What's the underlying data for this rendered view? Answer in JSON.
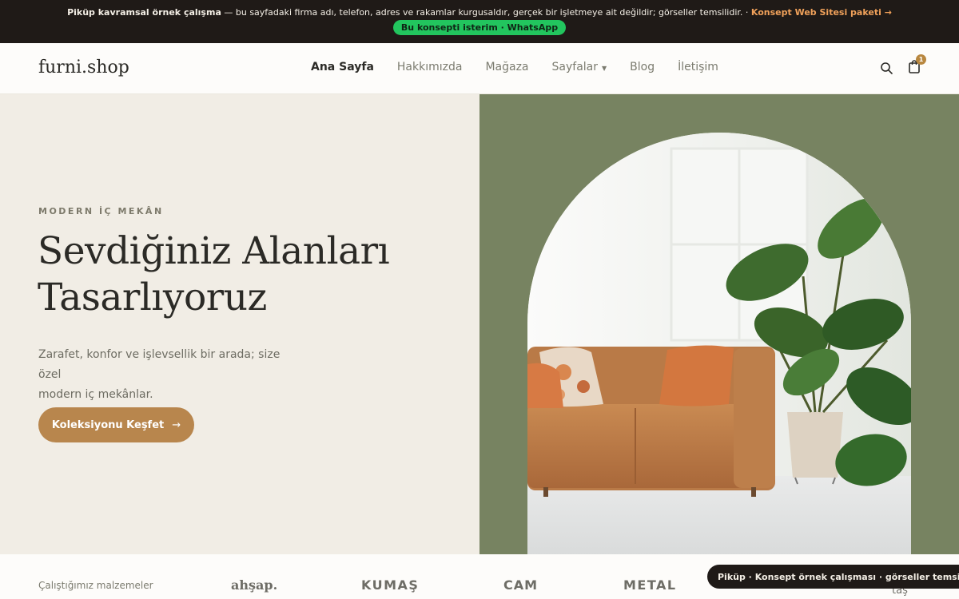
{
  "notice": {
    "strong": "Piküp kavramsal örnek çalışma",
    "text": " — bu sayfadaki firma adı, telefon, adres ve rakamlar kurgusaldır, gerçek bir işletmeye ait değildir; görseller temsilidir. · ",
    "link": "Konsept Web Sitesi paketi →",
    "whatsapp": "Bu konsepti isterim · WhatsApp"
  },
  "header": {
    "logo": "furni.shop",
    "nav": [
      "Ana Sayfa",
      "Hakkımızda",
      "Mağaza",
      "Sayfalar",
      "Blog",
      "İletişim"
    ],
    "active_nav": "Ana Sayfa",
    "cart_count": "1",
    "icons": [
      "search-icon",
      "shopping-bag-icon",
      "chevron-down-icon"
    ]
  },
  "hero": {
    "eyebrow": "MODERN İÇ MEKÂN",
    "title_line1": "Sevdiğiniz Alanları",
    "title_line2": "Tasarlıyoruz",
    "desc_line1": "Zarafet, konfor ve işlevsellik bir arada; size özel",
    "desc_line2": "modern iç mekânlar.",
    "cta": "Koleksiyonu Keşfet",
    "cta_arrow": "→"
  },
  "materials": {
    "label": "Çalıştığımız malzemeler",
    "items": [
      "ahşap.",
      "KUMAŞ",
      "CAM",
      "METAL",
      "taş"
    ]
  },
  "toast": "Piküp · Konsept örnek çalışması · görseller temsilidir",
  "colors": {
    "accent": "#b8864d",
    "hero_left_bg": "#f1ede5",
    "hero_right_bg": "#778361",
    "notice_bg": "#1f1a17",
    "whatsapp": "#22c55e"
  }
}
